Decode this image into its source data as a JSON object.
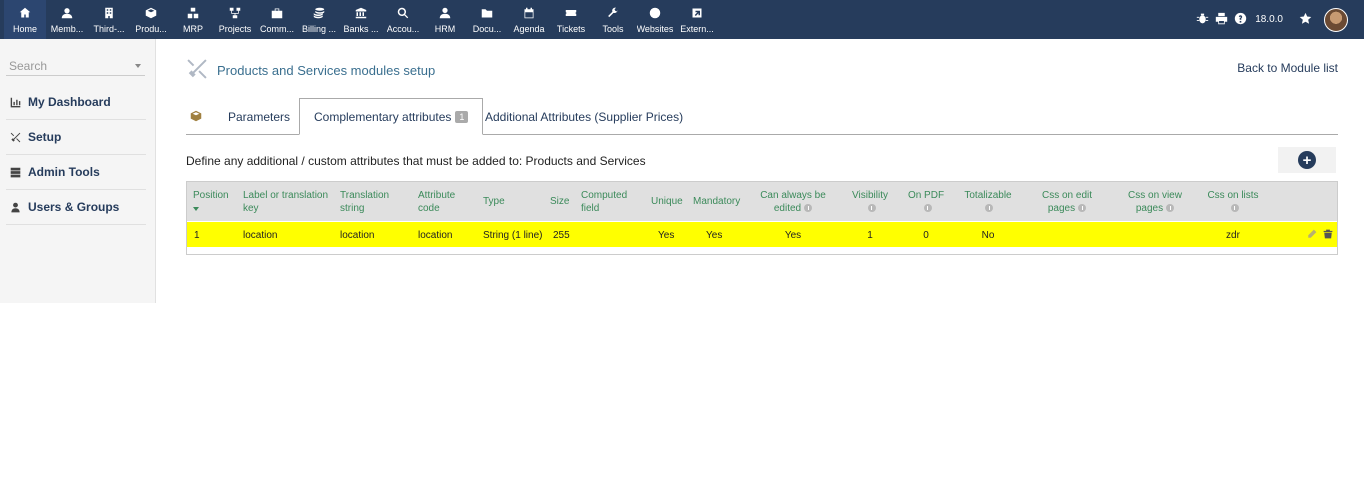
{
  "topnav": {
    "items": [
      {
        "label": "Home",
        "icon": "home-icon",
        "active": true
      },
      {
        "label": "Memb...",
        "icon": "user-icon"
      },
      {
        "label": "Third-...",
        "icon": "building-icon"
      },
      {
        "label": "Produ...",
        "icon": "cube-icon"
      },
      {
        "label": "MRP",
        "icon": "cubes-icon"
      },
      {
        "label": "Projects",
        "icon": "sitemap-icon"
      },
      {
        "label": "Comm...",
        "icon": "suitcase-icon"
      },
      {
        "label": "Billing ...",
        "icon": "coins-icon"
      },
      {
        "label": "Banks ...",
        "icon": "bank-icon"
      },
      {
        "label": "Accou...",
        "icon": "search-dollar-icon"
      },
      {
        "label": "HRM",
        "icon": "user-tie-icon"
      },
      {
        "label": "Docu...",
        "icon": "folder-icon"
      },
      {
        "label": "Agenda",
        "icon": "calendar-icon"
      },
      {
        "label": "Tickets",
        "icon": "ticket-icon"
      },
      {
        "label": "Tools",
        "icon": "wrench-icon"
      },
      {
        "label": "Websites",
        "icon": "globe-icon"
      },
      {
        "label": "Extern...",
        "icon": "external-link-icon"
      }
    ],
    "version": "18.0.0"
  },
  "sidebar": {
    "search_placeholder": "Search",
    "items": [
      {
        "label": "My Dashboard",
        "icon": "chart-icon"
      },
      {
        "label": "Setup",
        "icon": "tools-icon"
      },
      {
        "label": "Admin Tools",
        "icon": "server-icon"
      },
      {
        "label": "Users & Groups",
        "icon": "user-icon"
      }
    ]
  },
  "header": {
    "title": "Products and Services modules setup",
    "back_label": "Back to Module list"
  },
  "tabs": {
    "parameters": "Parameters",
    "complementary": "Complementary attributes",
    "complementary_count": "1",
    "additional": "Additional Attributes (Supplier Prices)"
  },
  "define_text": "Define any additional / custom attributes that must be added to: Products and Services",
  "table": {
    "headers": {
      "position": "Position",
      "label_key": "Label or translation key",
      "translation": "Translation string",
      "attr_code": "Attribute code",
      "type": "Type",
      "size": "Size",
      "computed": "Computed field",
      "unique": "Unique",
      "mandatory": "Mandatory",
      "always_edited": "Can always be edited",
      "visibility": "Visibility",
      "on_pdf": "On PDF",
      "totalizable": "Totalizable",
      "css_edit": "Css on edit pages",
      "css_view": "Css on view pages",
      "css_lists": "Css on lists"
    },
    "row": {
      "position": "1",
      "label_key": "location",
      "translation": "location",
      "attr_code": "location",
      "type": "String (1 line)",
      "size": "255",
      "computed": "",
      "unique": "Yes",
      "mandatory": "Yes",
      "always_edited": "Yes",
      "visibility": "1",
      "on_pdf": "0",
      "totalizable": "No",
      "css_edit": "",
      "css_view": "",
      "css_lists": "zdr"
    }
  },
  "colors": {
    "topbar": "#263c5c",
    "row_highlight": "#ffff00",
    "header_text": "#3b8a5a"
  }
}
